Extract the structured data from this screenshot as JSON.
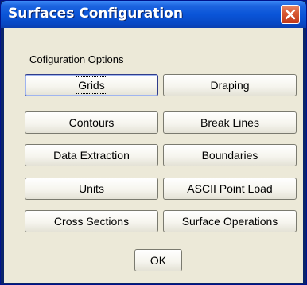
{
  "window": {
    "title": "Surfaces Configuration",
    "close_icon": "close-icon"
  },
  "options": {
    "label": "Cofiguration Options",
    "buttons": [
      "Grids",
      "Draping",
      "Contours",
      "Break Lines",
      "Data Extraction",
      "Boundaries",
      "Units",
      "ASCII Point Load",
      "Cross Sections",
      "Surface Operations"
    ]
  },
  "footer": {
    "ok_label": "OK"
  },
  "colors": {
    "titlebar": "#0a55d8",
    "client": "#ece9d8",
    "close_button": "#d85a34"
  }
}
